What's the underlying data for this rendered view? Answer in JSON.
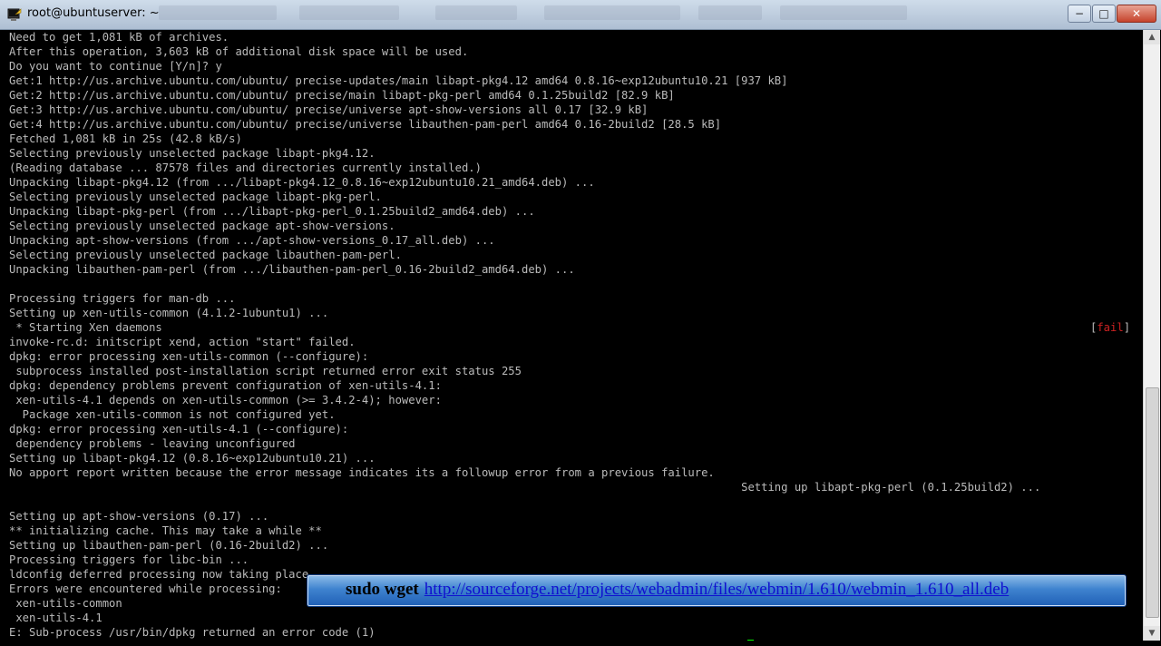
{
  "window": {
    "title": "root@ubuntuserver: ~",
    "buttons": {
      "minimize": "−",
      "maximize": "□",
      "close": "✕"
    }
  },
  "terminal": {
    "lines": [
      "Need to get 1,081 kB of archives.",
      "After this operation, 3,603 kB of additional disk space will be used.",
      "Do you want to continue [Y/n]? y",
      "Get:1 http://us.archive.ubuntu.com/ubuntu/ precise-updates/main libapt-pkg4.12 amd64 0.8.16~exp12ubuntu10.21 [937 kB]",
      "Get:2 http://us.archive.ubuntu.com/ubuntu/ precise/main libapt-pkg-perl amd64 0.1.25build2 [82.9 kB]",
      "Get:3 http://us.archive.ubuntu.com/ubuntu/ precise/universe apt-show-versions all 0.17 [32.9 kB]",
      "Get:4 http://us.archive.ubuntu.com/ubuntu/ precise/universe libauthen-pam-perl amd64 0.16-2build2 [28.5 kB]",
      "Fetched 1,081 kB in 25s (42.8 kB/s)",
      "Selecting previously unselected package libapt-pkg4.12.",
      "(Reading database ... 87578 files and directories currently installed.)",
      "Unpacking libapt-pkg4.12 (from .../libapt-pkg4.12_0.8.16~exp12ubuntu10.21_amd64.deb) ...",
      "Selecting previously unselected package libapt-pkg-perl.",
      "Unpacking libapt-pkg-perl (from .../libapt-pkg-perl_0.1.25build2_amd64.deb) ...",
      "Selecting previously unselected package apt-show-versions.",
      "Unpacking apt-show-versions (from .../apt-show-versions_0.17_all.deb) ...",
      "Selecting previously unselected package libauthen-pam-perl.",
      "Unpacking libauthen-pam-perl (from .../libauthen-pam-perl_0.16-2build2_amd64.deb) ...",
      "",
      "Processing triggers for man-db ...",
      "Setting up xen-utils-common (4.1.2-1ubuntu1) ...",
      " * Starting Xen daemons",
      "invoke-rc.d: initscript xend, action \"start\" failed.",
      "dpkg: error processing xen-utils-common (--configure):",
      " subprocess installed post-installation script returned error exit status 255",
      "dpkg: dependency problems prevent configuration of xen-utils-4.1:",
      " xen-utils-4.1 depends on xen-utils-common (>= 3.4.2-4); however:",
      "  Package xen-utils-common is not configured yet.",
      "dpkg: error processing xen-utils-4.1 (--configure):",
      " dependency problems - leaving unconfigured",
      "Setting up libapt-pkg4.12 (0.8.16~exp12ubuntu10.21) ...",
      "No apport report written because the error message indicates its a followup error from a previous failure.",
      "                                                                                                              Setting up libapt-pkg-perl (0.1.25build2) ...",
      "",
      "Setting up apt-show-versions (0.17) ...",
      "** initializing cache. This may take a while **",
      "Setting up libauthen-pam-perl (0.16-2build2) ...",
      "Processing triggers for libc-bin ...",
      "ldconfig deferred processing now taking place",
      "Errors were encountered while processing:",
      " xen-utils-common",
      " xen-utils-4.1",
      "E: Sub-process /usr/bin/dpkg returned an error code (1)"
    ],
    "prompt_line": "root@ubuntuserver:~# sudo wget http://sourceforge.net/projects/webadmin/files/webmin/1.610/webmin_1.610_all.deb",
    "fail_tag": {
      "open": "[",
      "word": "fail",
      "close": "]"
    }
  },
  "banner": {
    "command": "sudo wget",
    "link": "http://sourceforge.net/projects/webadmin/files/webmin/1.610/webmin_1.610_all.deb"
  },
  "colors": {
    "terminal_bg": "#000000",
    "terminal_fg": "#bbbbbb",
    "cursor": "#00ff00",
    "fail": "#cc2222",
    "banner": "#3f83cf"
  }
}
